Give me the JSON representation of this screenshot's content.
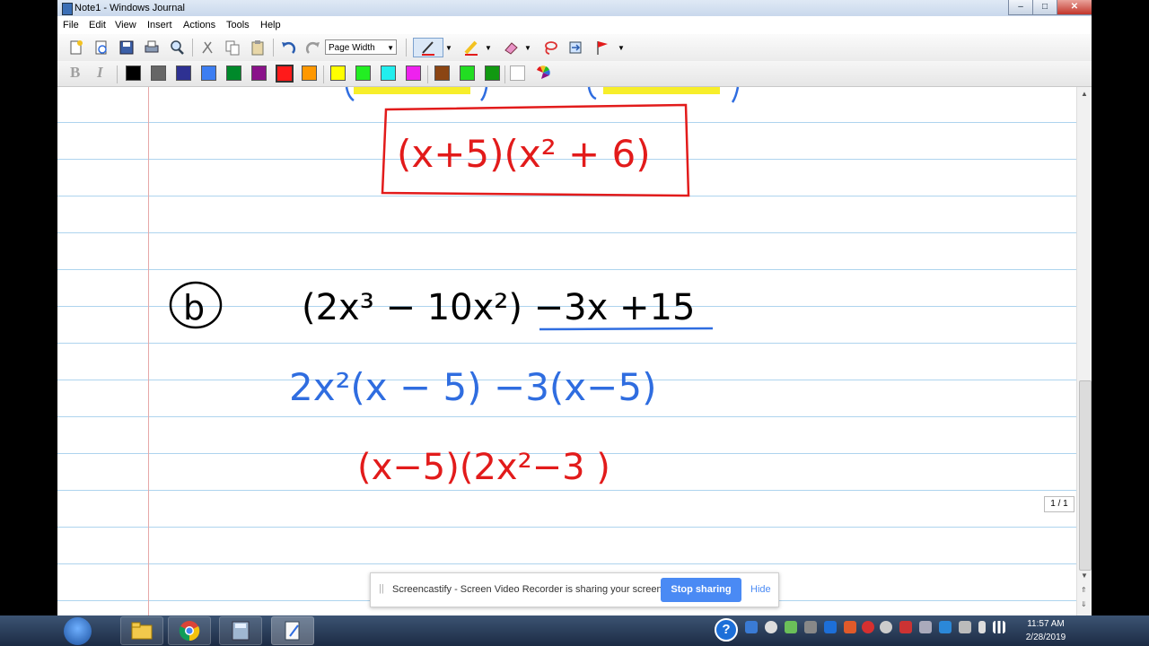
{
  "window": {
    "title": "Note1 - Windows Journal",
    "minimize": "–",
    "maximize": "□",
    "close": "✕"
  },
  "menu": [
    "File",
    "Edit",
    "View",
    "Insert",
    "Actions",
    "Tools",
    "Help"
  ],
  "toolbar": {
    "zoom_value": "Page Width",
    "icons": [
      "new-note-icon",
      "open-icon",
      "save-icon",
      "print-icon",
      "find-icon",
      "cut-icon",
      "copy-icon",
      "paste-icon",
      "undo-icon",
      "redo-icon",
      "pen-icon",
      "highlighter-icon",
      "eraser-icon",
      "lasso-icon",
      "insert-space-icon",
      "flag-icon"
    ]
  },
  "format": {
    "bold": "B",
    "italic": "I"
  },
  "palette": [
    "#000000",
    "#666666",
    "#2e3192",
    "#3d7ef2",
    "#00892a",
    "#8a138a",
    "#ff1a1a",
    "#ff9800",
    "#ffff00",
    "#22ee22",
    "#22eeee",
    "#ee22ee",
    "#8b4513",
    "#22dd22",
    "#119911",
    "#ffffff"
  ],
  "ink_colors": {
    "red": "#e21b1b",
    "blue": "#2f6de0",
    "black": "#000000",
    "highlight": "#f7ee2a"
  },
  "notes": {
    "boxed_answer": "(x+5)(x² + 6)",
    "label_b": "b",
    "line1": "(2x³ − 10x²) −3x +15",
    "line2": "2x²(x − 5) −3(x−5)",
    "line3": "(x−5)(2x²−3 )"
  },
  "page_indicator": "1 / 1",
  "share_banner": {
    "grip": "||",
    "message": "Screencastify - Screen Video Recorder is sharing your screen.",
    "stop_button": "Stop sharing",
    "hide_link": "Hide"
  },
  "taskbar": {
    "help": "?",
    "time": "11:57 AM",
    "date": "2/28/2019"
  }
}
